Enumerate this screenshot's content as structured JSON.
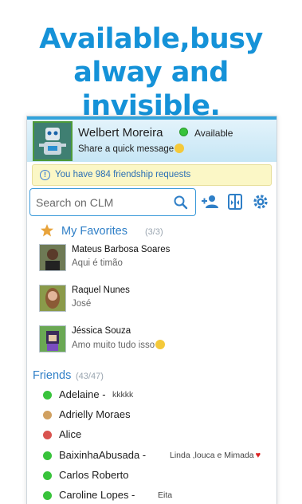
{
  "headline": {
    "line1": "Available,busy",
    "line2": "alway and invisible."
  },
  "profile": {
    "name": "Welbert Moreira",
    "status": "Available",
    "quick_message": "Share a quick message",
    "status_color": "#38c33b"
  },
  "requests": {
    "text": "You have 984 friendship requests"
  },
  "search": {
    "placeholder": "Search on CLM"
  },
  "toolbar": {
    "icons": [
      "search-icon",
      "add-friend-icon",
      "switch-icon",
      "settings-icon"
    ]
  },
  "favorites": {
    "title": "My Favorites",
    "count": "(3/3)",
    "items": [
      {
        "name": "Mateus Barbosa Soares",
        "message": "Aqui é timão"
      },
      {
        "name": "Raquel Nunes",
        "message": "José"
      },
      {
        "name": "Jéssica Souza",
        "message": "Amo muito tudo isso"
      }
    ]
  },
  "friends": {
    "title": "Friends",
    "count": "(43/47)",
    "items": [
      {
        "name": "Adelaine -",
        "message": "kkkkk",
        "status_color": "#38c33b"
      },
      {
        "name": "Adrielly Moraes",
        "message": "",
        "status_color": "#d0a060"
      },
      {
        "name": "Alice",
        "message": "",
        "status_color": "#d9534f"
      },
      {
        "name": "BaixinhaAbusada -",
        "message": "Linda ,louca e Mimada",
        "status_color": "#38c33b"
      },
      {
        "name": "Carlos Roberto",
        "message": "",
        "status_color": "#38c33b"
      },
      {
        "name": "Caroline Lopes -",
        "message": "Eita",
        "status_color": "#38c33b"
      }
    ]
  }
}
